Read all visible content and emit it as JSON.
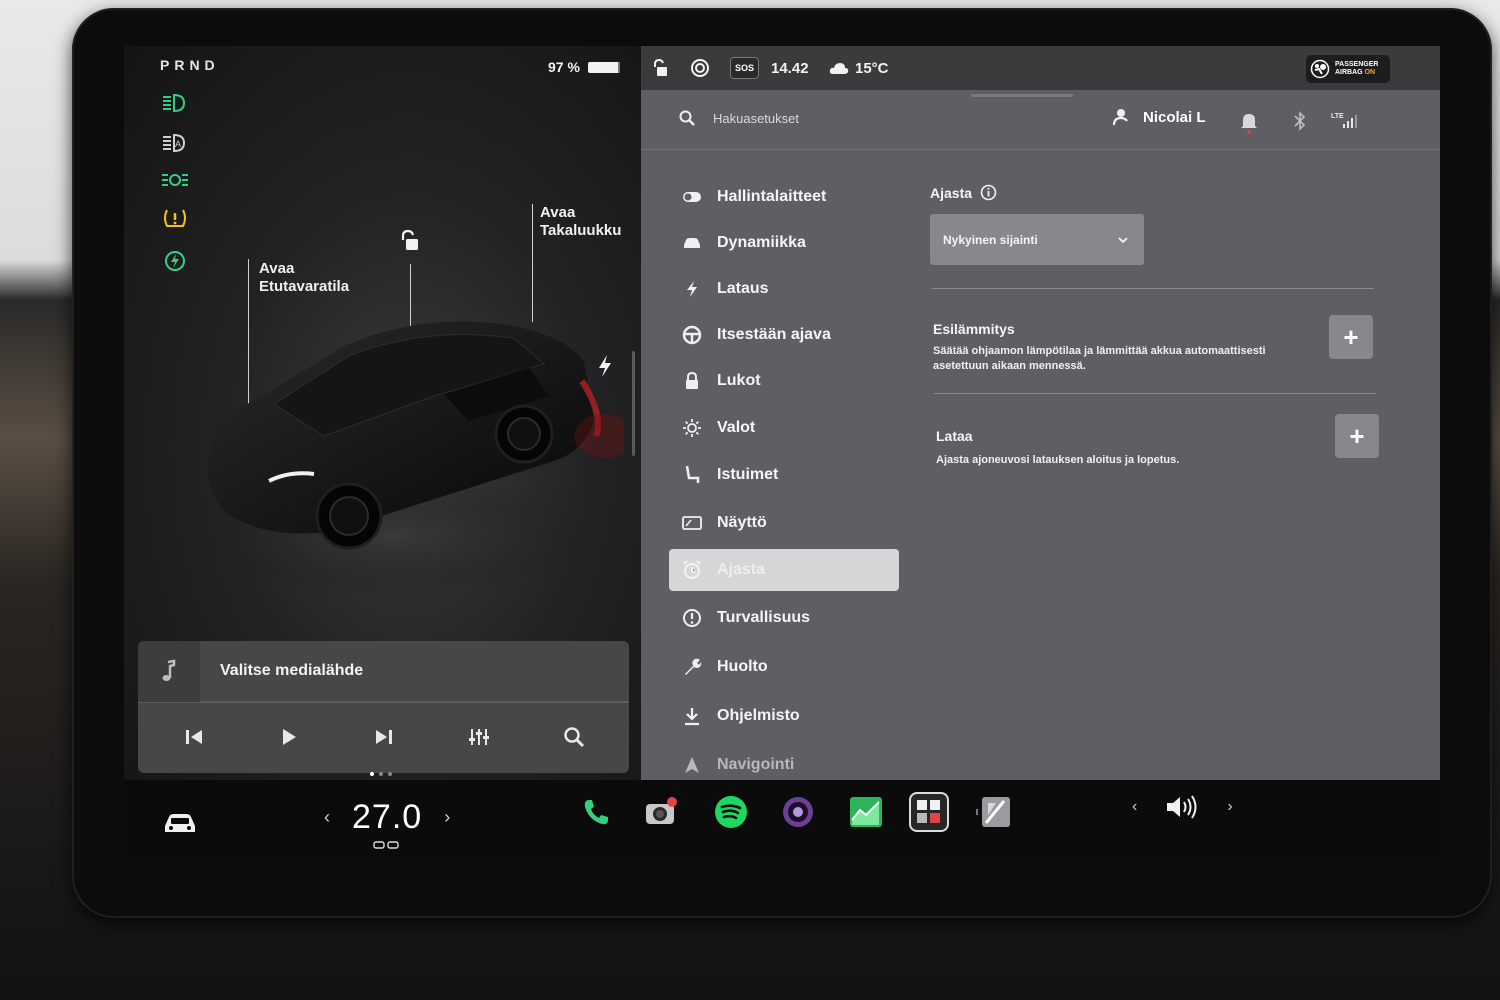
{
  "left_panel": {
    "gear": "PRND",
    "battery_percent": "97 %",
    "indicators": [
      "low-beam-headlight-icon",
      "auto-headlight-icon",
      "parking-lights-icon",
      "tire-pressure-warning-icon",
      "regen-icon"
    ],
    "frunk_label": "Avaa\nEtutavaratila",
    "trunk_label": "Avaa\nTakaluukku",
    "media": {
      "title": "Valitse medialähde",
      "controls": [
        "previous-icon",
        "play-icon",
        "next-icon",
        "equalizer-icon",
        "search-icon"
      ]
    }
  },
  "statusbar": {
    "sos_label": "SOS",
    "time": "14.42",
    "temperature": "15°C",
    "airbag_line1": "PASSENGER",
    "airbag_line2_prefix": "AIRBAG ",
    "airbag_line2_state": "ON",
    "lte_label": "LTE"
  },
  "search": {
    "placeholder": "Hakuasetukset"
  },
  "user": {
    "name": "Nicolai L"
  },
  "nav": {
    "items": [
      {
        "label": "Hallintalaitteet",
        "icon": "toggle-icon"
      },
      {
        "label": "Dynamiikka",
        "icon": "car-icon"
      },
      {
        "label": "Lataus",
        "icon": "bolt-icon"
      },
      {
        "label": "Itsestään ajava",
        "icon": "steering-wheel-icon"
      },
      {
        "label": "Lukot",
        "icon": "lock-icon"
      },
      {
        "label": "Valot",
        "icon": "sun-icon"
      },
      {
        "label": "Istuimet",
        "icon": "seat-icon"
      },
      {
        "label": "Näyttö",
        "icon": "display-icon"
      },
      {
        "label": "Ajasta",
        "icon": "alarm-clock-icon"
      },
      {
        "label": "Turvallisuus",
        "icon": "info-circle-icon"
      },
      {
        "label": "Huolto",
        "icon": "wrench-icon"
      },
      {
        "label": "Ohjelmisto",
        "icon": "download-icon"
      },
      {
        "label": "Navigointi",
        "icon": "navigation-arrow-icon"
      }
    ],
    "active": "Ajasta"
  },
  "schedule": {
    "title": "Ajasta",
    "location_dropdown": "Nykyinen sijainti",
    "preconditioning": {
      "title": "Esilämmitys",
      "description": "Säätää ohjaamon lämpötilaa ja lämmittää akkua automaattisesti asetettuun aikaan mennessä.",
      "button": "+"
    },
    "charging": {
      "title": "Lataa",
      "description": "Ajasta ajoneuvosi latauksen aloitus ja lopetus.",
      "button": "+"
    }
  },
  "taskbar": {
    "climate_temp": "27.0",
    "left_arrow": "‹",
    "right_arrow": "›",
    "vol_left": "‹",
    "vol_right": "›",
    "apps": [
      "phone-icon",
      "camera-icon",
      "spotify-icon",
      "theater-icon",
      "energy-chart-icon",
      "toybox-icon",
      "browser-icon"
    ]
  },
  "colors": {
    "indicator_green": "#35d07f",
    "warning_yellow": "#f1c40f",
    "settings_bg": "#5f5f63",
    "spotify_green": "#1ed760"
  }
}
